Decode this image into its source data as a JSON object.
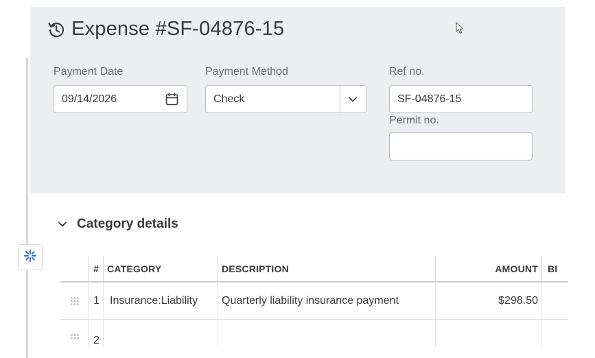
{
  "header": {
    "title": "Expense #SF-04876-15"
  },
  "form": {
    "payment_date": {
      "label": "Payment Date",
      "value": "09/14/2026"
    },
    "payment_method": {
      "label": "Payment Method",
      "value": "Check"
    },
    "ref_no": {
      "label": "Ref no.",
      "value": "SF-04876-15"
    },
    "permit_no": {
      "label": "Permit no.",
      "value": ""
    }
  },
  "category_section": {
    "title": "Category details",
    "columns": {
      "num": "#",
      "category": "CATEGORY",
      "description": "DESCRIPTION",
      "amount": "AMOUNT",
      "billable": "BI"
    },
    "rows": [
      {
        "num": "1",
        "category": "Insurance:Liability",
        "description": "Quarterly liability insurance payment",
        "amount": "$298.50"
      },
      {
        "num": "2",
        "category": "",
        "description": "",
        "amount": ""
      }
    ]
  },
  "colors": {
    "header_bg": "#eceef1",
    "text": "#393a3d",
    "label": "#6b6c72",
    "border": "#babec5",
    "widget_accent": "#2d6ad6"
  },
  "icons": {
    "title": "history-icon",
    "date": "calendar-icon",
    "select": "chevron-down-icon",
    "section": "chevron-down-icon",
    "widget": "sparkle-icon",
    "row": "drag-handle-icon"
  }
}
